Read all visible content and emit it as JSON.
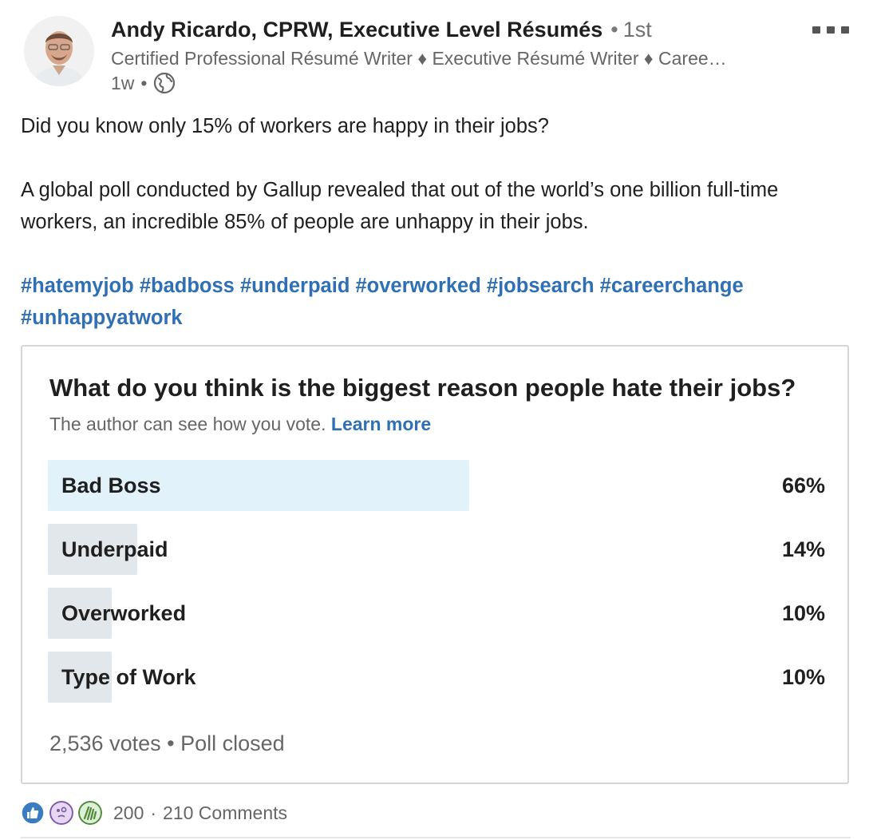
{
  "author": {
    "name": "Andy Ricardo, CPRW, Executive Level Résumés",
    "degree": "1st",
    "headline": "Certified Professional Résumé Writer ♦ Executive Résumé Writer ♦ Caree…",
    "posted": "1w",
    "visibility_icon": "globe-icon"
  },
  "post": {
    "paragraph1": "Did you know only 15% of workers are happy in their jobs?",
    "paragraph2": "A global poll conducted by Gallup revealed that out of the world’s one billion full-time workers, an incredible 85% of people are unhappy in their jobs.",
    "hashtags": [
      "#hatemyjob",
      "#badboss",
      "#underpaid",
      "#overworked",
      "#jobsearch",
      "#careerchange",
      "#unhappyatwork"
    ]
  },
  "poll": {
    "question": "What do you think is the biggest reason people hate their jobs?",
    "note": "The author can see how you vote.",
    "learn_more": "Learn more",
    "options": [
      {
        "label": "Bad Boss",
        "percent_text": "66%",
        "percent": 66,
        "leading": true
      },
      {
        "label": "Underpaid",
        "percent_text": "14%",
        "percent": 14,
        "leading": false
      },
      {
        "label": "Overworked",
        "percent_text": "10%",
        "percent": 10,
        "leading": false
      },
      {
        "label": "Type of Work",
        "percent_text": "10%",
        "percent": 10,
        "leading": false
      }
    ],
    "votes": "2,536 votes",
    "status": "Poll closed"
  },
  "social": {
    "reactions": [
      "like-icon",
      "curious-icon",
      "celebrate-icon"
    ],
    "reaction_count": "200",
    "comments": "210 Comments"
  },
  "colors": {
    "link": "#2f6fb3",
    "leading_bar": "#e2f2fb",
    "other_bar": "#e1e7ea",
    "text": "#1f1f1f",
    "muted": "#666666"
  }
}
